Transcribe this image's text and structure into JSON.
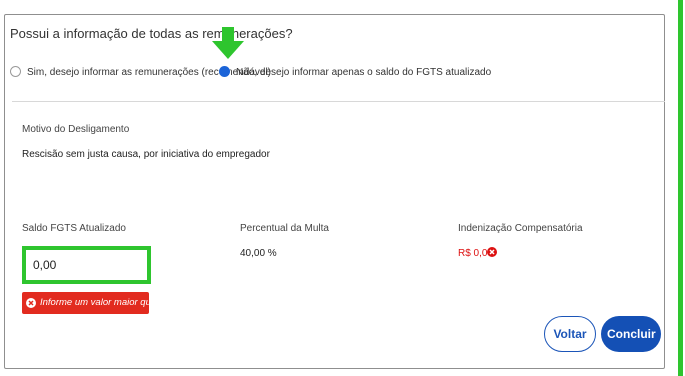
{
  "question": "Possui a informação de todas as remunerações?",
  "options": [
    {
      "label": "Sim, desejo informar as remunerações (recomendável)",
      "selected": false
    },
    {
      "label": "Não, desejo informar apenas o saldo do FGTS atualizado",
      "selected": true
    }
  ],
  "motivo": {
    "label": "Motivo do Desligamento",
    "value": "Rescisão sem justa causa, por iniciativa do empregador"
  },
  "saldo": {
    "label": "Saldo FGTS Atualizado",
    "value": "0,00",
    "error": "Informe um valor maior que zero"
  },
  "percentual": {
    "label": "Percentual da Multa",
    "value": "40,00 %"
  },
  "indenizacao": {
    "label": "Indenização Compensatória",
    "value": "R$ 0,00"
  },
  "buttons": {
    "voltar": "Voltar",
    "concluir": "Concluir"
  },
  "colors": {
    "accent": "#1450b5",
    "highlight": "#2ec52e",
    "error": "#e22b1f"
  }
}
